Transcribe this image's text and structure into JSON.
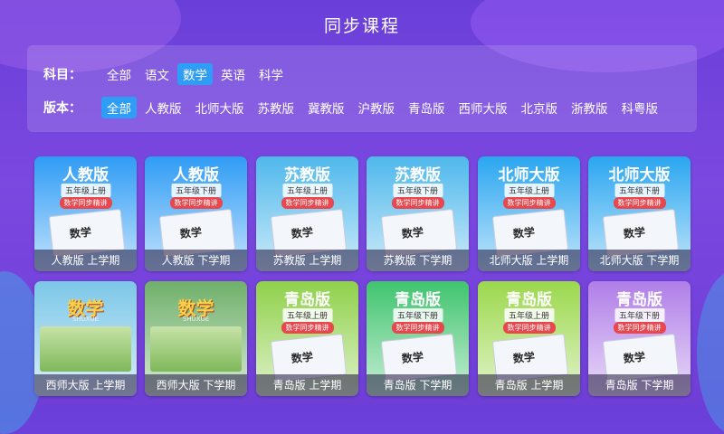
{
  "page": {
    "title": "同步课程"
  },
  "filters": {
    "subject_label": "科目：",
    "subjects": [
      {
        "label": "全部",
        "selected": false
      },
      {
        "label": "语文",
        "selected": false
      },
      {
        "label": "数学",
        "selected": true
      },
      {
        "label": "英语",
        "selected": false
      },
      {
        "label": "科学",
        "selected": false
      }
    ],
    "edition_label": "版本：",
    "editions": [
      {
        "label": "全部",
        "selected": true
      },
      {
        "label": "人教版",
        "selected": false
      },
      {
        "label": "北师大版",
        "selected": false
      },
      {
        "label": "苏教版",
        "selected": false
      },
      {
        "label": "冀教版",
        "selected": false
      },
      {
        "label": "沪教版",
        "selected": false
      },
      {
        "label": "青岛版",
        "selected": false
      },
      {
        "label": "西师大版",
        "selected": false
      },
      {
        "label": "北京版",
        "selected": false
      },
      {
        "label": "浙教版",
        "selected": false
      },
      {
        "label": "科粤版",
        "selected": false
      }
    ]
  },
  "courses": [
    {
      "caption": "人教版 上学期",
      "publisher": "人教版",
      "grade": "五年级上册",
      "tag": "数学同步精讲",
      "book_word": "数学",
      "color": "#2f9cf5"
    },
    {
      "caption": "人教版 下学期",
      "publisher": "人教版",
      "grade": "五年级下册",
      "tag": "数学同步精讲",
      "book_word": "数学",
      "color": "#2f9cf5"
    },
    {
      "caption": "苏教版 上学期",
      "publisher": "苏教版",
      "grade": "五年级上册",
      "tag": "数学同步精讲",
      "book_word": "数学",
      "color": "#4fb8ec"
    },
    {
      "caption": "苏教版 下学期",
      "publisher": "苏教版",
      "grade": "五年级下册",
      "tag": "数学同步精讲",
      "book_word": "数学",
      "color": "#4fb8ec"
    },
    {
      "caption": "北师大版 上学期",
      "publisher": "北师大版",
      "grade": "五年级上册",
      "tag": "数学同步精讲",
      "book_word": "数学",
      "color": "#2aa6f0"
    },
    {
      "caption": "北师大版 下学期",
      "publisher": "北师大版",
      "grade": "五年级下册",
      "tag": "数学同步精讲",
      "book_word": "数学",
      "color": "#2aa6f0"
    },
    {
      "caption": "西师大版 上学期",
      "publisher": "数学",
      "grade": "SHUXUE",
      "tag": "",
      "book_word": "",
      "color": "#7cc7e8"
    },
    {
      "caption": "西师大版 下学期",
      "publisher": "数学",
      "grade": "SHUXUE",
      "tag": "",
      "book_word": "",
      "color": "#6fb06a"
    },
    {
      "caption": "青岛版 上学期",
      "publisher": "青岛版",
      "grade": "五年级上册",
      "tag": "数学同步精讲",
      "book_word": "数学",
      "color": "#8fd14a"
    },
    {
      "caption": "青岛版 下学期",
      "publisher": "青岛版",
      "grade": "五年级下册",
      "tag": "数学同步精讲",
      "book_word": "数学",
      "color": "#3fc46e"
    },
    {
      "caption": "青岛版 上学期",
      "publisher": "青岛版",
      "grade": "五年级上册",
      "tag": "数学同步精讲",
      "book_word": "数学",
      "color": "#9bd84c"
    },
    {
      "caption": "青岛版 下学期",
      "publisher": "青岛版",
      "grade": "五年级下册",
      "tag": "数学同步精讲",
      "book_word": "数学",
      "color": "#b07ee8"
    }
  ]
}
